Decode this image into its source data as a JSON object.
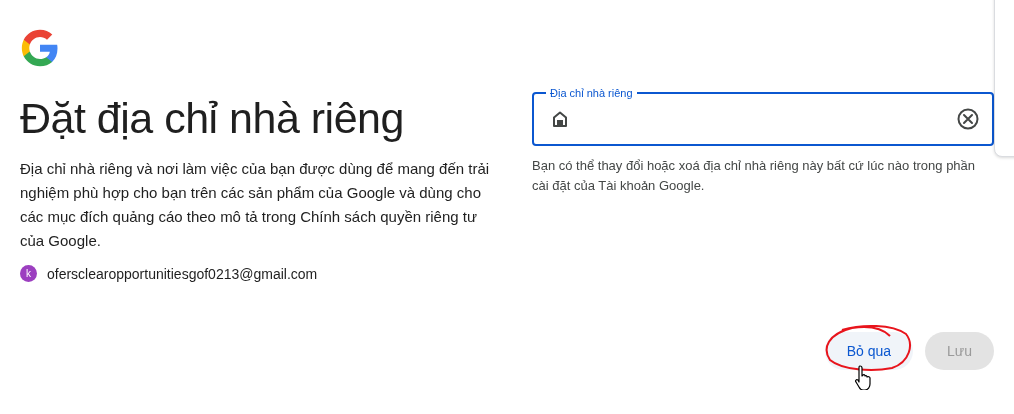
{
  "title": "Đặt địa chỉ nhà riêng",
  "description": "Địa chỉ nhà riêng và nơi làm việc của bạn được dùng để mang đến trải nghiệm phù hợp cho bạn trên các sản phẩm của Google và dùng cho các mục đích quảng cáo theo mô tả trong Chính sách quyền riêng tư của Google.",
  "account": {
    "avatar_letter": "k",
    "email": "ofersclearopportunitiesgof0213@gmail.com"
  },
  "address_field": {
    "label": "Địa chỉ nhà riêng",
    "focused": true
  },
  "helper_text": "Bạn có thể thay đổi hoặc xoá địa chỉ nhà riêng này bất cứ lúc nào trong phần cài đặt của Tài khoản Google.",
  "buttons": [
    {
      "label": "Bỏ qua",
      "kind": "text",
      "disabled": false
    },
    {
      "label": "Lưu",
      "kind": "filled",
      "disabled": true
    }
  ]
}
